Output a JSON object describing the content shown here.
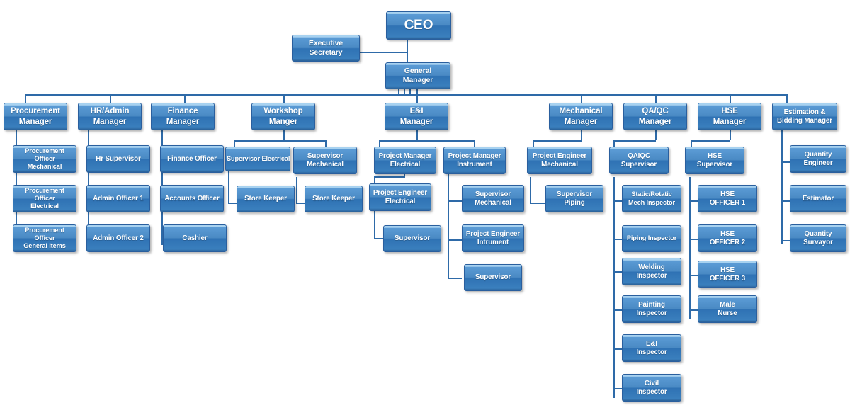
{
  "chart": {
    "title": "Organization Chart",
    "type": "org-chart",
    "accent_color": "#4a8ac4",
    "line_color": "#2e6aa8",
    "text_color": "#ffffff"
  },
  "nodes": {
    "ceo": "CEO",
    "executive_secretary": "Executive\nSecretary",
    "general_manager": "General\nManager",
    "procurement_manager": "Procurement\nManager",
    "procurement_officer_mechanical": "Procurement Officer\nMechanical",
    "procurement_officer_electrical": "Procurement Officer\nElectrical",
    "procurement_officer_general_items": "Procurement Officer\nGeneral Items",
    "hr_admin_manager": "HR/Admin\nManager",
    "hr_supervisor": "Hr Supervisor",
    "admin_officer_1": "Admin Officer 1",
    "admin_officer_2": "Admin Officer 2",
    "finance_manager": "Finance\nManager",
    "finance_officer": "Finance Officer",
    "accounts_officer": "Accounts  Officer",
    "cashier": "Cashier",
    "workshop_manager": "Workshop\nManger",
    "supervisor_electrical": "Supervisor Electrical",
    "supervisor_mechanical_ws": "Supervisor\nMechanical",
    "store_keeper_1": "Store Keeper",
    "store_keeper_2": "Store Keeper",
    "ei_manager": "E&I\nManager",
    "project_manager_electrical": "Project Manager\nElectrical",
    "project_engineer_electrical": "Project Engineer\nElectrical",
    "supervisor_ei_elec": "Supervisor",
    "project_manager_instrument": "Project Manager\nInstrument",
    "supervisor_mechanical_ei": "Supervisor\nMechanical",
    "project_engineer_instrument": "Project Engineer\nIntrument",
    "supervisor_ei_inst": "Supervisor",
    "mechanical_manager": "Mechanical\nManager",
    "project_engineer_mechanical": "Project  Engineer\nMechanical",
    "supervisor_piping": "Supervisor\nPiping",
    "qaqc_manager": "QA/QC\nManager",
    "qaqc_supervisor": "QAIQC\nSupervisor",
    "static_rotatic_mech_inspector": "Static/Rotatic\nMech Inspector",
    "piping_inspector": "Piping Inspector",
    "welding_inspector": "Welding\nInspector",
    "painting_inspector": "Painting\nInspector",
    "ei_inspector": "E&I\nInspector",
    "civil_inspector": "Civil\nInspector",
    "hse_manager": "HSE\nManager",
    "hse_supervisor": "HSE\nSupervisor",
    "hse_officer_1": "HSE\nOFFICER 1",
    "hse_officer_2": "HSE\nOFFICER 2",
    "hse_officer_3": "HSE\nOFFICER 3",
    "male_nurse": "Male\nNurse",
    "estimation_bidding_manager": "Estimation &\nBidding Manager",
    "quantity_engineer": "Quantity\nEngineer",
    "estimator": "Estimator",
    "quantity_survayor": "Quantity\nSurvayor"
  }
}
